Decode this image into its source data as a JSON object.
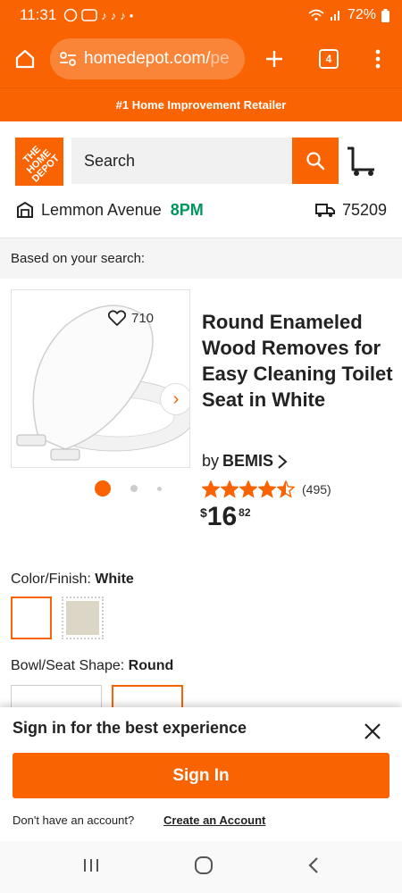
{
  "status_bar": {
    "time": "11:31",
    "battery": "72%",
    "icons": [
      "whatsapp-icon",
      "badge-icon",
      "tiktok-icon",
      "tiktok-icon",
      "tiktok-icon",
      "dot-icon",
      "wifi-icon",
      "signal-icon",
      "battery-icon"
    ]
  },
  "browser": {
    "url_main": "homedepot.com/",
    "url_fade": "pe",
    "tab_count": "4"
  },
  "promo": {
    "text": "#1 Home Improvement Retailer"
  },
  "header": {
    "logo_text": "THE HOME DEPOT",
    "search_placeholder": "Search",
    "store_name": "Lemmon Avenue",
    "store_hours": "8PM",
    "zip": "75209"
  },
  "based_on": {
    "text": "Based on your search:"
  },
  "product": {
    "favorites": "710",
    "title": "Round Enameled Wood Removes for Easy Cleaning Toilet Seat in White",
    "brand_prefix": "by",
    "brand": "BEMIS",
    "rating_value": 4.5,
    "review_count": "(495)",
    "price_symbol": "$",
    "price_dollars": "16",
    "price_cents": "82",
    "image_count": 3,
    "active_image": 1
  },
  "options": {
    "color_label": "Color/Finish:",
    "color_value": "White",
    "shape_label": "Bowl/Seat Shape:",
    "shape_value": "Round",
    "swatches": [
      {
        "name": "White",
        "color": "#ffffff",
        "selected": true
      },
      {
        "name": "Almond",
        "color": "#dcd6c7",
        "selected": false
      }
    ]
  },
  "signin_sheet": {
    "title": "Sign in for the best experience",
    "button": "Sign In",
    "no_account": "Don't have an account?",
    "create_link": "Create an Account"
  },
  "colors": {
    "brand_orange": "#f96302",
    "hours_green": "#00965e"
  }
}
